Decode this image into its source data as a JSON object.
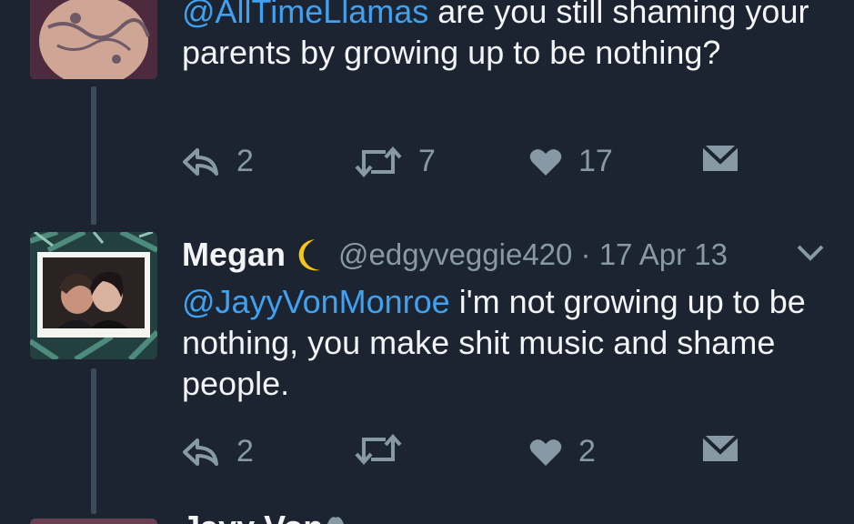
{
  "tweet1": {
    "mention": "@AllTimeLlamas",
    "text": " are you still shaming your parents by growing up to be nothing?",
    "reply_count": "2",
    "retweet_count": "7",
    "like_count": "17"
  },
  "tweet2": {
    "display_name": "Megan",
    "handle_date": "@edgyveggie420 · 17 Apr 13",
    "mention": "@JayyVonMonroe",
    "text": " i'm not growing up to be nothing, you make shit music and shame people.",
    "reply_count": "2",
    "retweet_count": "",
    "like_count": "2"
  },
  "tweet3": {
    "display_name_partial": "Jayy Von"
  },
  "colors": {
    "background": "#1b2430",
    "link": "#3fa1ef",
    "muted": "#8899a6",
    "text": "#f2f4f6",
    "moon": "#f5c518"
  },
  "icons": [
    "reply-icon",
    "retweet-icon",
    "heart-icon",
    "direct-message-icon",
    "chevron-down-icon",
    "moon-emoji",
    "verified-badge-icon"
  ]
}
